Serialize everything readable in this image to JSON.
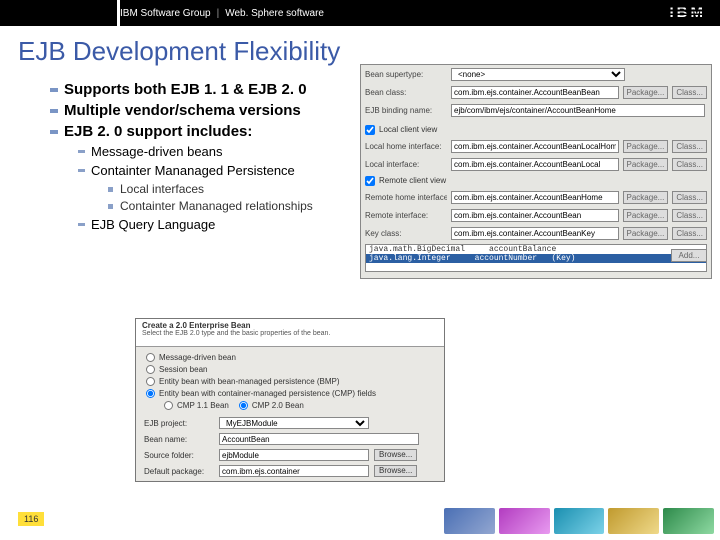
{
  "header": {
    "group": "IBM Software Group",
    "product": "Web. Sphere software",
    "logo_text": "IBM"
  },
  "title": "EJB Development Flexibility",
  "bullets": {
    "b1_1": "Supports both EJB 1. 1 & EJB 2. 0",
    "b1_2": "Multiple vendor/schema versions",
    "b1_3": "EJB 2. 0 support includes:",
    "b2_1": "Message-driven beans",
    "b2_2": "Containter Mananaged Persistence",
    "b3_1": "Local interfaces",
    "b3_2": "Containter Mananaged relationships",
    "b2_3": "EJB Query Language"
  },
  "dlg_right": {
    "bean_supertype_lbl": "Bean supertype:",
    "bean_supertype_val": "<none>",
    "bean_class_lbl": "Bean class:",
    "bean_class_val": "com.ibm.ejs.container.AccountBeanBean",
    "ejb_binding_lbl": "EJB binding name:",
    "ejb_binding_val": "ejb/com/ibm/ejs/container/AccountBeanHome",
    "local_client_chk": "Local client view",
    "local_home_lbl": "Local home interface:",
    "local_home_val": "com.ibm.ejs.container.AccountBeanLocalHome",
    "local_intf_lbl": "Local interface:",
    "local_intf_val": "com.ibm.ejs.container.AccountBeanLocal",
    "remote_client_chk": "Remote client view",
    "remote_home_lbl": "Remote home interface:",
    "remote_home_val": "com.ibm.ejs.container.AccountBeanHome",
    "remote_intf_lbl": "Remote interface:",
    "remote_intf_val": "com.ibm.ejs.container.AccountBean",
    "key_class_lbl": "Key class:",
    "key_class_val": "com.ibm.ejs.container.AccountBeanKey",
    "tbl_row1_a": "java.math.BigDecimal",
    "tbl_row1_b": "accountBalance",
    "tbl_row2_a": "java.lang.Integer",
    "tbl_row2_b": "accountNumber",
    "tbl_row2_c": "(Key)",
    "btn_package": "Package...",
    "btn_class": "Class...",
    "btn_add": "Add..."
  },
  "dlg_bottom": {
    "title": "Create a 2.0 Enterprise Bean",
    "subtitle": "Select the EJB 2.0 type and the basic properties of the bean.",
    "r1": "Message-driven bean",
    "r2": "Session bean",
    "r3": "Entity bean with bean-managed persistence (BMP)",
    "r4": "Entity bean with container-managed persistence (CMP) fields",
    "sub_r4a": "CMP 1.1 Bean",
    "sub_r4b": "CMP 2.0 Bean",
    "proj_lbl": "EJB project:",
    "proj_val": "MyEJBModule",
    "name_lbl": "Bean name:",
    "name_val": "AccountBean",
    "src_lbl": "Source folder:",
    "src_val": "ejbModule",
    "pkg_lbl": "Default package:",
    "pkg_val": "com.ibm.ejs.container",
    "btn_browse": "Browse..."
  },
  "page_number": "116"
}
